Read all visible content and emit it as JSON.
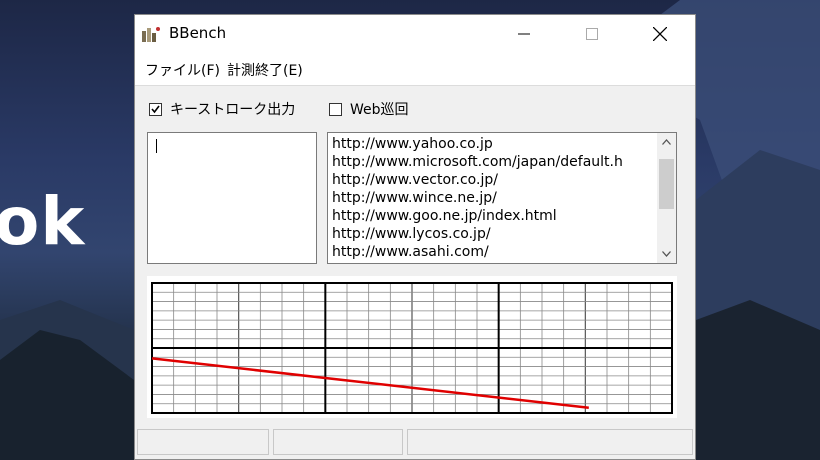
{
  "desktop": {
    "text": "ok"
  },
  "window": {
    "title": "BBench",
    "controls": {
      "minimize": "—",
      "maximize": "☐",
      "close": "✕"
    }
  },
  "menu": [
    {
      "label": "ファイル(F)"
    },
    {
      "label": "計測終了(E)"
    }
  ],
  "options": {
    "keystroke": {
      "label": "キーストローク出力",
      "checked": true
    },
    "web_patrol": {
      "label": "Web巡回",
      "checked": false
    }
  },
  "urls": [
    "http://www.yahoo.co.jp",
    "http://www.microsoft.com/japan/default.h",
    "http://www.vector.co.jp/",
    "http://www.wince.ne.jp/",
    "http://www.goo.ne.jp/index.html",
    "http://www.lycos.co.jp/",
    "http://www.asahi.com/"
  ],
  "graph": {
    "line_color": "#e00000",
    "level_start": 0.42,
    "level_end": 0.04,
    "progress": 0.84
  },
  "icons": {
    "app": "bbench-app-icon",
    "scroll_up": "chevron-up-icon",
    "scroll_down": "chevron-down-icon"
  }
}
